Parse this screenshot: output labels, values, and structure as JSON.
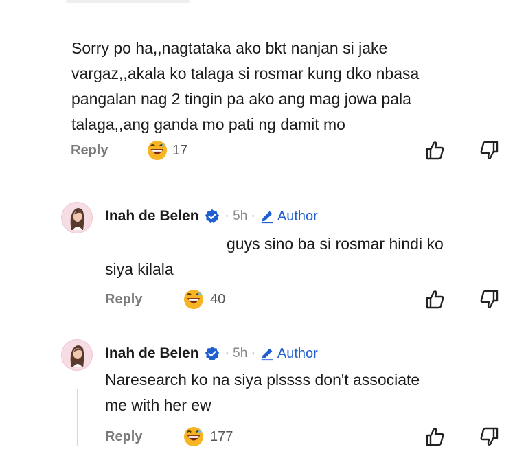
{
  "comments": [
    {
      "text_lines": [
        "Sorry po ha,,nagtataka ako bkt nanjan si jake",
        "vargaz,,akala ko talaga si rosmar kung dko nbasa",
        "pangalan nag 2 tingin pa ako ang mag jowa pala",
        "talaga,,ang ganda mo pati ng damit mo"
      ],
      "reply_label": "Reply",
      "reaction_count": "17"
    },
    {
      "author_name": "Inah de Belen",
      "time": "· 5h ·",
      "badge_label": "Author",
      "text_lines": [
        "guys sino ba si rosmar hindi ko",
        "siya kilala"
      ],
      "reply_label": "Reply",
      "reaction_count": "40"
    },
    {
      "author_name": "Inah de Belen",
      "time": "· 5h ·",
      "badge_label": "Author",
      "text_lines": [
        "Naresearch ko na siya plssss don't associate",
        "me with her ew"
      ],
      "reply_label": "Reply",
      "reaction_count": "177"
    }
  ],
  "icons": {
    "reaction": "grinning-sweat-emoji-icon",
    "like": "thumbs-up-icon",
    "dislike": "thumbs-down-icon",
    "verified": "verified-badge-icon",
    "author": "pencil-icon"
  },
  "colors": {
    "author_badge": "#1f5fd0",
    "verified": "#1f5fd0",
    "reply": "#7a7a7a"
  }
}
